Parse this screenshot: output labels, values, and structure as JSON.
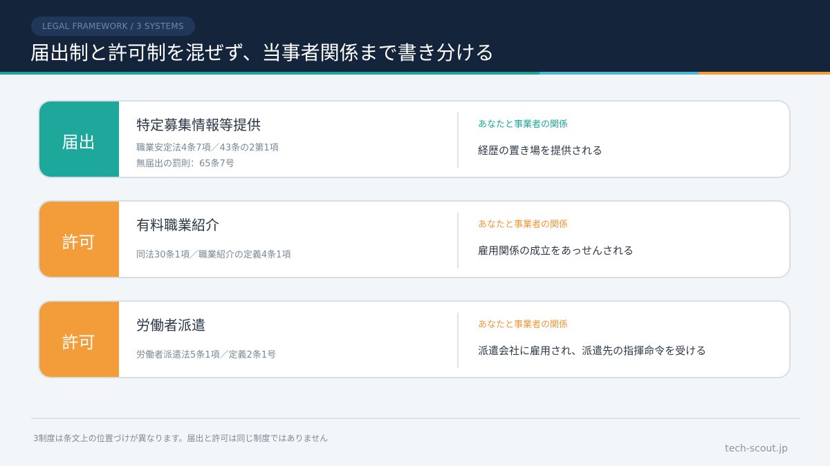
{
  "header": {
    "tag": "LEGAL FRAMEWORK / 3 SYSTEMS",
    "title": "届出制と許可制を混ぜず、当事者関係まで書き分ける",
    "accent_colors": [
      "#1aa398",
      "#48b8d6",
      "#f39c3a"
    ]
  },
  "cards": [
    {
      "badge": "届出",
      "badge_color": "#1ea89c",
      "name": "特定募集情報等提供",
      "lines": [
        "職業安定法4条7項／43条の2第1項",
        "無届出の罰則：65条7号"
      ],
      "rel_label": "あなたと事業者の関係",
      "rel_text": "経歴の置き場を提供される"
    },
    {
      "badge": "許可",
      "badge_color": "#f39c3a",
      "name": "有料職業紹介",
      "lines": [
        "同法30条1項／職業紹介の定義4条1項"
      ],
      "rel_label": "あなたと事業者の関係",
      "rel_text": "雇用関係の成立をあっせんされる"
    },
    {
      "badge": "許可",
      "badge_color": "#f39c3a",
      "name": "労働者派遣",
      "lines": [
        "労働者派遣法5条1項／定義2条1号"
      ],
      "rel_label": "あなたと事業者の関係",
      "rel_text": "派遣会社に雇用され、派遣先の指揮命令を受ける"
    }
  ],
  "footer": {
    "note": "3制度は条文上の位置づけが異なります。届出と許可は同じ制度ではありません",
    "brand": "tech-scout.jp"
  }
}
